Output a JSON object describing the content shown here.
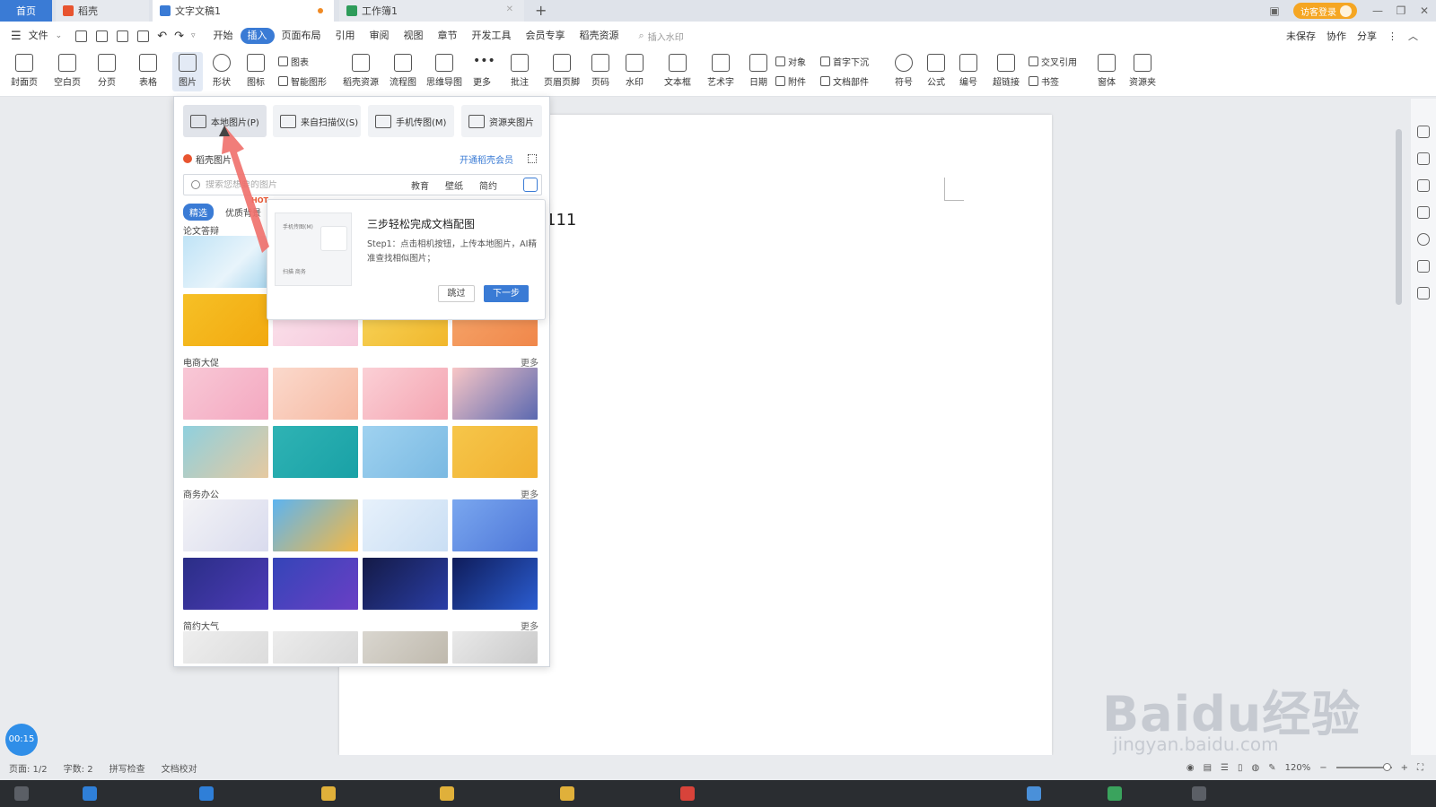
{
  "tabs": [
    {
      "label": "首页"
    },
    {
      "label": "稻壳"
    },
    {
      "label": "文字文稿1"
    },
    {
      "label": "工作簿1"
    }
  ],
  "titlebar": {
    "login": "访客登录",
    "add_tab": "+"
  },
  "menu": {
    "file": "文件",
    "items": [
      "开始",
      "插入",
      "页面布局",
      "引用",
      "审阅",
      "视图",
      "章节",
      "开发工具",
      "会员专享",
      "稻壳资源"
    ],
    "search_placeholder": "插入水印",
    "right": [
      "未保存",
      "协作",
      "分享"
    ]
  },
  "ribbon": {
    "large": [
      "封面页",
      "空白页",
      "分页",
      "表格",
      "图片",
      "形状",
      "图标"
    ],
    "small_a": [
      "图表",
      "智能图形"
    ],
    "large2": [
      "稻壳资源",
      "流程图",
      "思维导图",
      "更多",
      "批注",
      "页眉页脚",
      "页码",
      "水印",
      "文本框",
      "艺术字",
      "日期"
    ],
    "small_b": [
      "对象",
      "附件",
      "首字下沉",
      "文档部件"
    ],
    "large3": [
      "符号",
      "公式",
      "编号",
      "超链接"
    ],
    "small_c": [
      "交叉引用",
      "书签"
    ],
    "large4": [
      "窗体",
      "资源夹"
    ]
  },
  "picture_menu": {
    "sources": [
      "本地图片(P)",
      "来自扫描仪(S)",
      "手机传图(M)",
      "资源夹图片"
    ],
    "docer_label": "稻壳图片",
    "vip_link": "开通稻壳会员",
    "search_placeholder": "搜索您想要的图片",
    "keywords": [
      "教育",
      "壁纸",
      "简约"
    ],
    "chips": [
      "精选",
      "优质背景"
    ],
    "hot": "HOT",
    "categories": [
      {
        "title": "论文答辩",
        "more": ""
      },
      {
        "title": "电商大促",
        "more": "更多"
      },
      {
        "title": "商务办公",
        "more": "更多"
      },
      {
        "title": "简约大气",
        "more": "更多"
      }
    ]
  },
  "tooltip": {
    "preview_top": "手机传图(M)",
    "preview_bottom": "扫描  商务",
    "title": "三步轻松完成文档配图",
    "body": "Step1：点击相机按钮，上传本地图片，AI精准查找相似图片；",
    "skip": "跳过",
    "next": "下一步"
  },
  "document": {
    "text": "111"
  },
  "status": {
    "page": "页面: 1/2",
    "words": "字数: 2",
    "spell": "拼写检查",
    "proof": "文档校对",
    "zoom": "120%"
  },
  "timer": "00:15",
  "watermark": {
    "main": "Baidu经验",
    "sub": "jingyan.baidu.com"
  },
  "colors": {
    "accent": "#3a7bd5",
    "orange": "#f5a623",
    "hot": "#e8542f"
  }
}
